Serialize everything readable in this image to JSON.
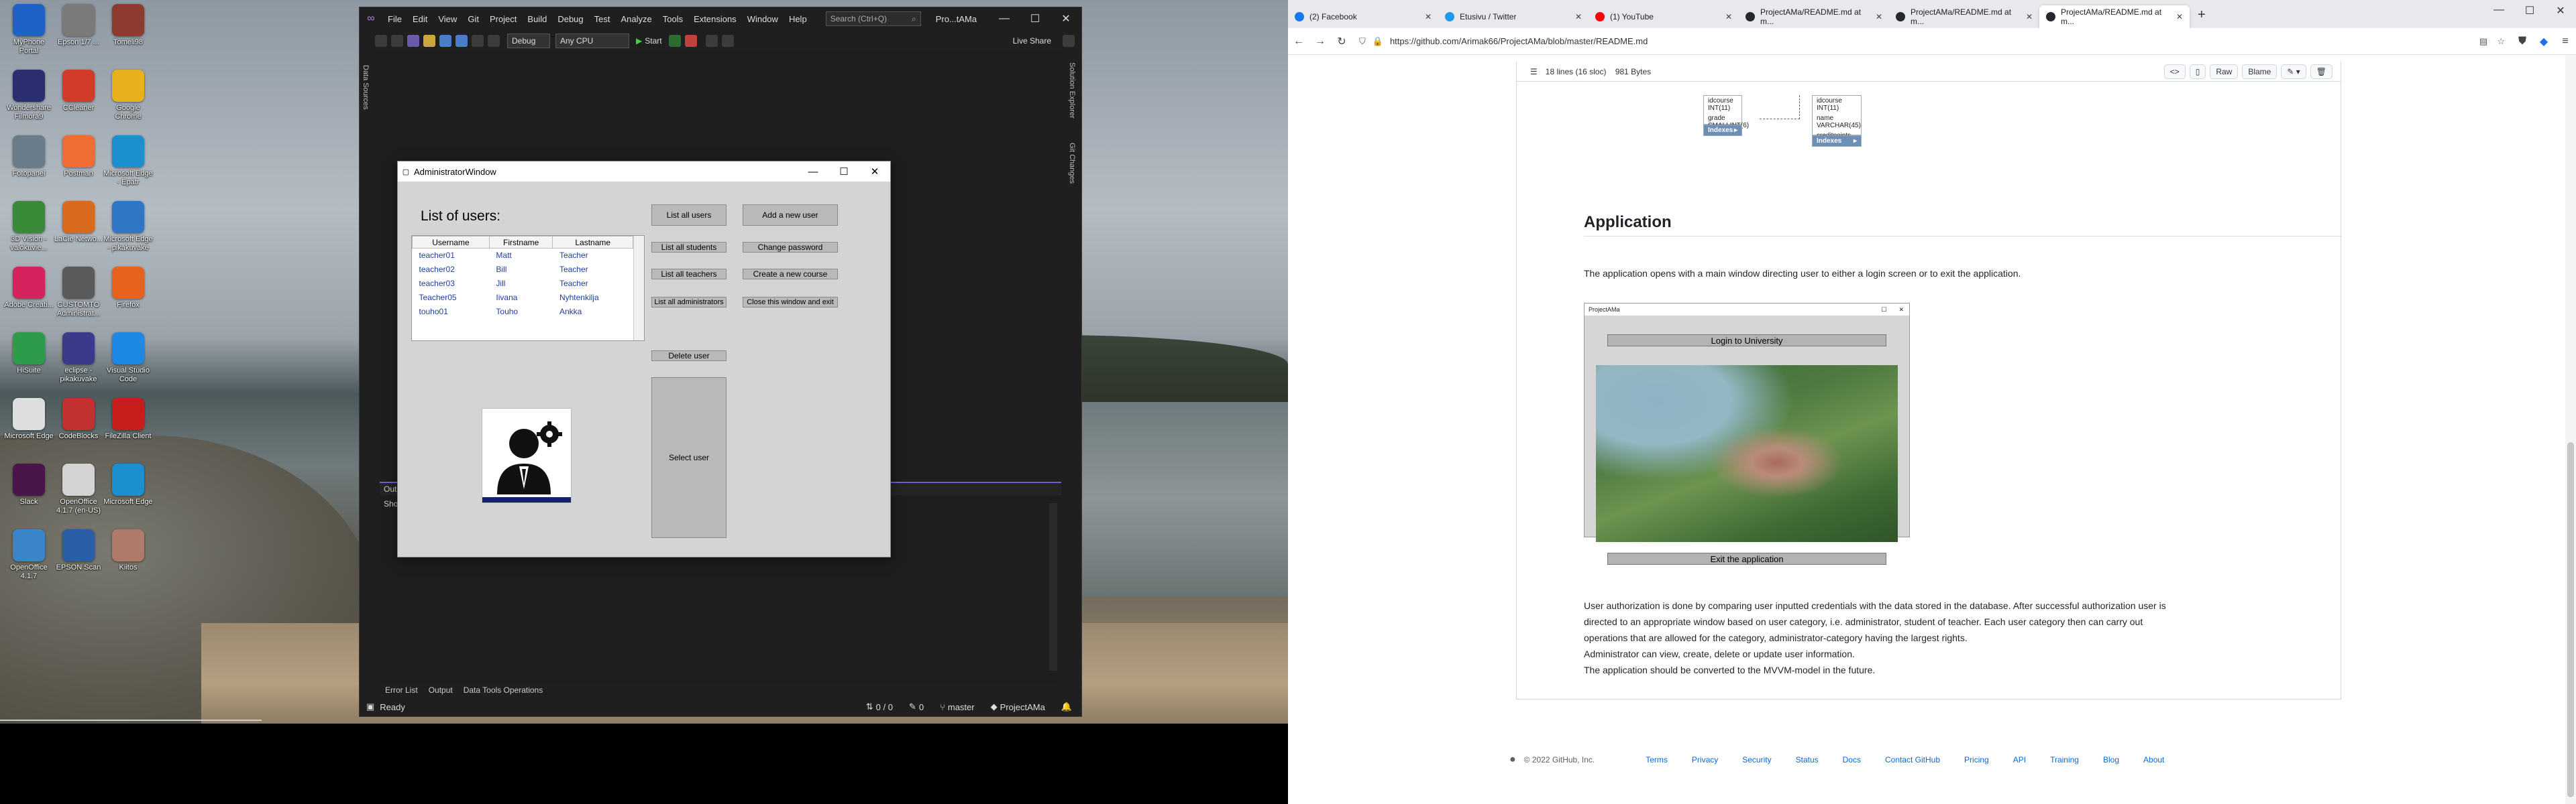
{
  "desktop": {
    "icons": [
      {
        "label": "MyPhone Portal",
        "icon": "phone-icon",
        "color": "#1d62c4"
      },
      {
        "label": "Epson 1/7 ...",
        "icon": "printer-icon",
        "color": "#7a7a7a"
      },
      {
        "label": "Tomeli98",
        "icon": "user-icon",
        "color": "#8c3b2e"
      },
      {
        "label": "Wondershare Filmora9",
        "icon": "film-icon",
        "color": "#2b2e6e"
      },
      {
        "label": "CCleaner",
        "icon": "ccleaner-icon",
        "color": "#d23a2a"
      },
      {
        "label": "Google Chrome",
        "icon": "chrome-icon",
        "color": "#e8b01c"
      },
      {
        "label": "Fotopanel",
        "icon": "photo-icon",
        "color": "#6a7c8a"
      },
      {
        "label": "Postman",
        "icon": "postman-icon",
        "color": "#ef6c34"
      },
      {
        "label": "Microsoft Edge - Epätr",
        "icon": "edge-icon",
        "color": "#1b8fd0"
      },
      {
        "label": "3D Vision -valokuvie...",
        "icon": "3d-vision-icon",
        "color": "#3a8a3a"
      },
      {
        "label": "LaCie Netwo...",
        "icon": "lacie-icon",
        "color": "#d96a1d"
      },
      {
        "label": "Microsoft Edge - pikakuvake",
        "icon": "edge-shortcut-icon",
        "color": "#2f77c6"
      },
      {
        "label": "Adobe Creati...",
        "icon": "adobe-icon",
        "color": "#d5235e"
      },
      {
        "label": "CUSTOMTO Administrat...",
        "icon": "tools-icon",
        "color": "#5a5a5a"
      },
      {
        "label": "Firefox",
        "icon": "firefox-icon",
        "color": "#e8621d"
      },
      {
        "label": "HiSuite",
        "icon": "hisuite-icon",
        "color": "#2d9b4a"
      },
      {
        "label": "eclipse - pikakuvake",
        "icon": "eclipse-icon",
        "color": "#3b3a8a"
      },
      {
        "label": "Visual Studio Code",
        "icon": "vscode-icon",
        "color": "#1e88e5"
      },
      {
        "label": "Microsoft Edge",
        "icon": "edge-icon-2",
        "color": "#dedede"
      },
      {
        "label": "CodeBlocks",
        "icon": "codeblocks-icon",
        "color": "#c23030"
      },
      {
        "label": "FileZilla Client",
        "icon": "filezilla-icon",
        "color": "#c81d1d"
      },
      {
        "label": "Slack",
        "icon": "slack-icon",
        "color": "#4a154b"
      },
      {
        "label": "OpenOffice 4.1.7 (en-US)",
        "icon": "openoffice-icon",
        "color": "#d3d3d3"
      },
      {
        "label": "Microsoft Edge",
        "icon": "edge-icon-3",
        "color": "#1b8fd0"
      },
      {
        "label": "OpenOffice 4.1.7",
        "icon": "openoffice-icon-2",
        "color": "#3a86c8"
      },
      {
        "label": "EPSON Scan",
        "icon": "scanner-icon",
        "color": "#2a5fa8"
      },
      {
        "label": "Kiitos",
        "icon": "user-icon-2",
        "color": "#b07a6a"
      }
    ]
  },
  "vs": {
    "menus": [
      "File",
      "Edit",
      "View",
      "Git",
      "Project",
      "Build",
      "Debug",
      "Test",
      "Analyze",
      "Tools",
      "Extensions",
      "Window",
      "Help"
    ],
    "search_placeholder": "Search (Ctrl+Q)",
    "project_title": "Pro...tAMa",
    "config": "Debug",
    "platform": "Any CPU",
    "start_label": "Start",
    "live_share": "Live Share",
    "left_rail": "Data Sources",
    "right_rail_1": "Solution Explorer",
    "right_rail_2": "Git Changes",
    "output_title": "Out",
    "output_show": "Sho",
    "bottom_tabs": [
      "Error List",
      "Output",
      "Data Tools Operations"
    ],
    "status": {
      "ready": "Ready",
      "sync": "0 / 0",
      "changes": "0",
      "branch": "master",
      "repo": "ProjectAMa"
    }
  },
  "admin": {
    "title": "AdministratorWindow",
    "list_label": "List of users:",
    "columns": [
      "Username",
      "Firstname",
      "Lastname"
    ],
    "rows": [
      [
        "teacher01",
        "Matt",
        "Teacher"
      ],
      [
        "teacher02",
        "Bill",
        "Teacher"
      ],
      [
        "teacher03",
        "Jill",
        "Teacher"
      ],
      [
        "Teacher05",
        "Iivana",
        "Nyhtenkilja"
      ],
      [
        "touho01",
        "Touho",
        "Ankka"
      ]
    ],
    "buttons": {
      "list_all_users": "List all users",
      "add_new_user": "Add a new user",
      "list_all_students": "List all students",
      "change_password": "Change password",
      "list_all_teachers": "List all teachers",
      "create_new_course": "Create a new course",
      "list_all_administrators": "List all administrators",
      "close_window": "Close this window and exit",
      "delete_user": "Delete user",
      "select_user": "Select user"
    }
  },
  "browser": {
    "tabs": [
      {
        "label": "(2) Facebook",
        "color": "#1877f2"
      },
      {
        "label": "Etusivu / Twitter",
        "color": "#1d9bf0"
      },
      {
        "label": "(1) YouTube",
        "color": "#ff0000"
      },
      {
        "label": "ProjectAMa/README.md at m...",
        "color": "#24292f"
      },
      {
        "label": "ProjectAMa/README.md at m...",
        "color": "#24292f"
      },
      {
        "label": "ProjectAMa/README.md at m...",
        "color": "#24292f",
        "active": true
      }
    ],
    "url": "https://github.com/Arimak66/ProjectAMa/blob/master/README.md",
    "file_info": "18 lines (16 sloc)    981 Bytes",
    "file_buttons": [
      "Raw",
      "Blame"
    ],
    "erd": {
      "left_rows": [
        "idcourse INT(11)",
        "grade SMALLINT(6)"
      ],
      "left_foot": "Indexes",
      "right_head": "",
      "right_rows": [
        "idcourse INT(11)",
        "name VARCHAR(45)",
        "creditpoints SMALLINT(6)"
      ],
      "right_foot": "Indexes"
    },
    "heading": "Application",
    "para1": "The application opens with a main window directing user to either a login screen or to exit the application.",
    "shot": {
      "title": "ProjectAMa",
      "login_button": "Login to University",
      "exit_button": "Exit the application"
    },
    "para2": [
      "User authorization is done by comparing user inputted credentials with the data stored in the database. After successful authorization user is",
      "directed to an appropriate window based on user category, i.e. administrator, student of teacher. Each user category then can carry out",
      "operations that are allowed for the category, administrator-category having the largest rights.",
      "Administrator can view, create, delete or update user information.",
      "The application should be converted to the MVVM-model in the future."
    ],
    "footer": {
      "copyright": "© 2022 GitHub, Inc.",
      "links": [
        "Terms",
        "Privacy",
        "Security",
        "Status",
        "Docs",
        "Contact GitHub",
        "Pricing",
        "API",
        "Training",
        "Blog",
        "About"
      ]
    }
  }
}
